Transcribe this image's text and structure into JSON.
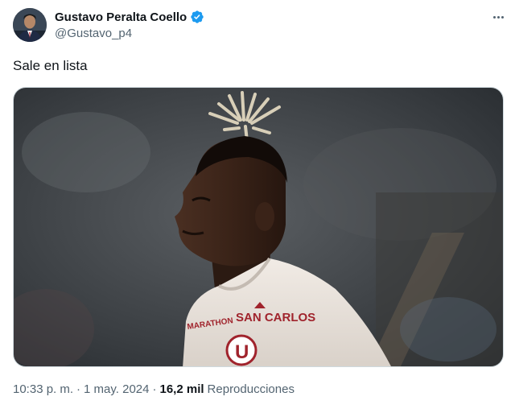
{
  "author": {
    "display_name": "Gustavo Peralta Coello",
    "handle": "@Gustavo_p4",
    "verified": true
  },
  "tweet": {
    "text": "Sale en lista"
  },
  "meta": {
    "time": "10:33 p. m.",
    "separator": "·",
    "date": "1 may. 2024",
    "views_count": "16,2 mil",
    "views_label": "Reproducciones"
  },
  "media": {
    "jersey_sponsor": "SAN CARLOS",
    "jersey_badge": "U",
    "jersey_side_text": "MARATHON"
  },
  "icons": {
    "verified": "verified-badge-icon",
    "more": "more-icon"
  },
  "colors": {
    "verified_blue": "#1d9bf0",
    "secondary_text": "#536471",
    "primary_text": "#0f1419"
  }
}
